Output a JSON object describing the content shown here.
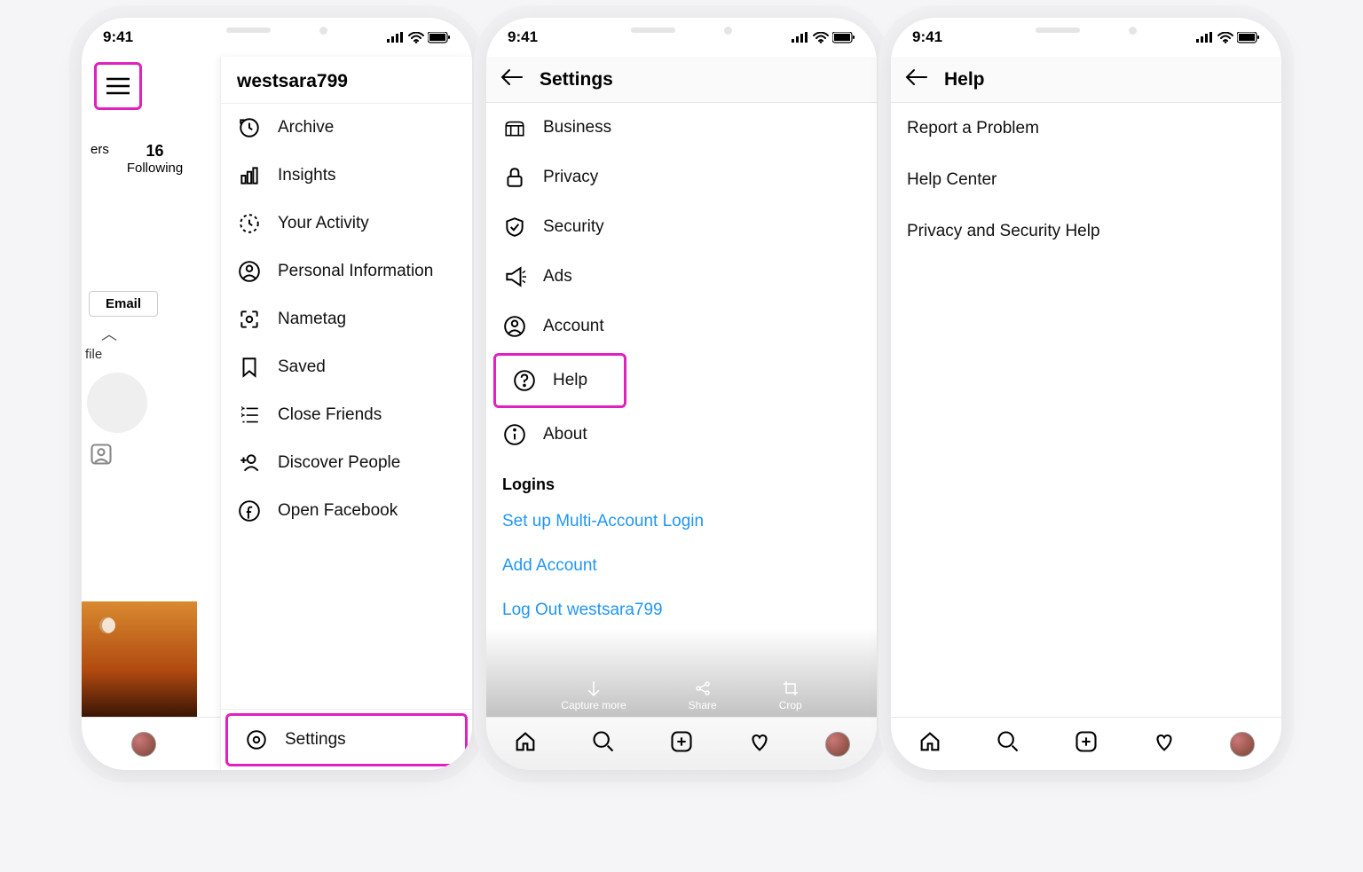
{
  "status": {
    "time": "9:41"
  },
  "phone1": {
    "username": "westsara799",
    "stats": {
      "following_count": "16",
      "following_label": "Following",
      "ers_label": "ers"
    },
    "email_button": "Email",
    "file_label": "file",
    "drawer": {
      "items": [
        {
          "id": "archive",
          "label": "Archive"
        },
        {
          "id": "insights",
          "label": "Insights"
        },
        {
          "id": "your-activity",
          "label": "Your Activity"
        },
        {
          "id": "personal-info",
          "label": "Personal Information"
        },
        {
          "id": "nametag",
          "label": "Nametag"
        },
        {
          "id": "saved",
          "label": "Saved"
        },
        {
          "id": "close-friends",
          "label": "Close Friends"
        },
        {
          "id": "discover-people",
          "label": "Discover People"
        },
        {
          "id": "open-facebook",
          "label": "Open Facebook"
        }
      ],
      "settings_label": "Settings"
    }
  },
  "phone2": {
    "header_title": "Settings",
    "items": [
      {
        "id": "business",
        "label": "Business"
      },
      {
        "id": "privacy",
        "label": "Privacy"
      },
      {
        "id": "security",
        "label": "Security"
      },
      {
        "id": "ads",
        "label": "Ads"
      },
      {
        "id": "account",
        "label": "Account"
      },
      {
        "id": "help",
        "label": "Help"
      },
      {
        "id": "about",
        "label": "About"
      }
    ],
    "logins_section": "Logins",
    "login_links": {
      "multi": "Set up Multi-Account Login",
      "add": "Add Account",
      "logout": "Log Out westsara799"
    },
    "toolbar": {
      "capture": "Capture more",
      "share": "Share",
      "crop": "Crop"
    }
  },
  "phone3": {
    "header_title": "Help",
    "items": [
      {
        "label": "Report a Problem"
      },
      {
        "label": "Help Center"
      },
      {
        "label": "Privacy and Security Help"
      }
    ]
  }
}
